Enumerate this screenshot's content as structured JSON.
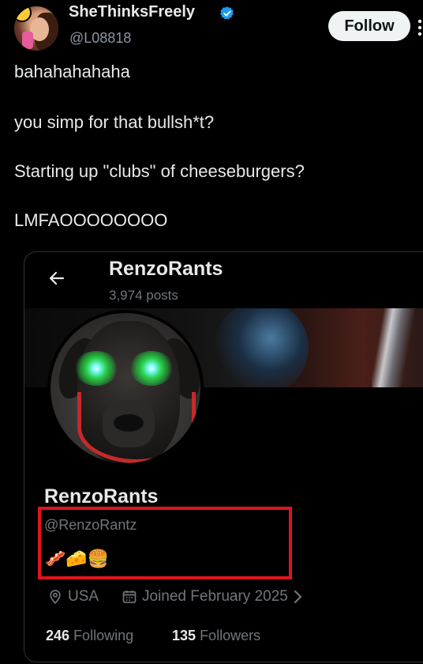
{
  "tweet": {
    "author": {
      "display_name": "SheThinksFreely",
      "handle": "@L08818",
      "verified": true
    },
    "follow_label": "Follow",
    "lines": [
      "bahahahahaha",
      "you simp for that bullsh*t?",
      "Starting up \"clubs\" of cheeseburgers?",
      "LMFAOOOOOOOO"
    ]
  },
  "embedded_profile": {
    "name": "RenzoRants",
    "posts": "3,974 posts",
    "profile_name": "RenzoRants",
    "handle": "@RenzoRantz",
    "bio": "🥓🧀🍔",
    "location": "USA",
    "joined": "Joined February 2025",
    "following_count": "246",
    "following_label": "Following",
    "followers_count": "135",
    "followers_label": "Followers"
  },
  "icons": {
    "verified": "verified-badge-icon",
    "back": "back-arrow-icon",
    "location": "location-pin-icon",
    "calendar": "calendar-icon",
    "chevron": "chevron-right-icon"
  },
  "colors": {
    "background": "#000000",
    "text": "#e7e9ea",
    "muted": "#71767b",
    "verified": "#1d9bf0",
    "highlight": "#e0141e"
  }
}
